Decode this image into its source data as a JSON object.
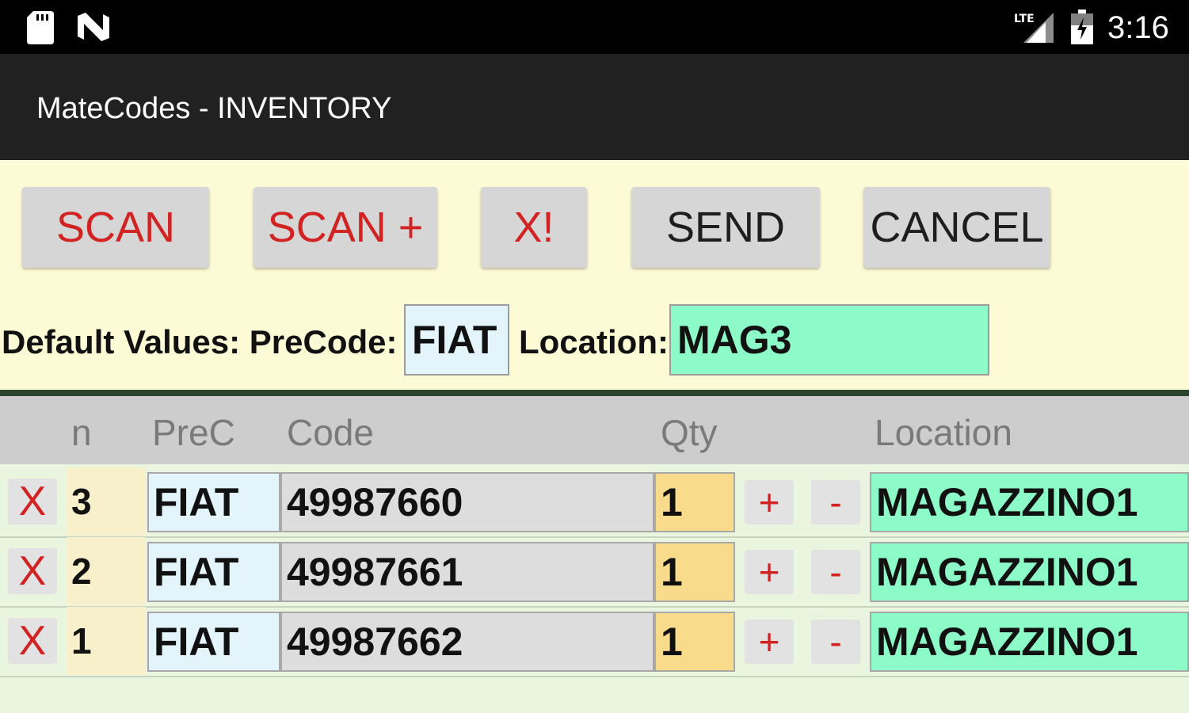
{
  "status_bar": {
    "time": "3:16",
    "icons": [
      "sd-card-icon",
      "nfc-icon",
      "lte-signal-icon",
      "battery-charging-icon"
    ]
  },
  "app": {
    "title": "MateCodes - INVENTORY"
  },
  "toolbar": {
    "scan_label": "SCAN",
    "scan_plus_label": "SCAN +",
    "delete_all_label": "X!",
    "send_label": "SEND",
    "cancel_label": "CANCEL"
  },
  "defaults": {
    "label": "Default Values: PreCode:",
    "precode_value": "FIAT",
    "location_label": "Location:",
    "location_value": "MAG3"
  },
  "table": {
    "headers": {
      "n": "n",
      "prec": "PreC",
      "code": "Code",
      "qty": "Qty",
      "location": "Location"
    },
    "rows": [
      {
        "delete": "X",
        "n": "3",
        "prec": "FIAT",
        "code": "49987660",
        "qty": "1",
        "plus": "+",
        "minus": "-",
        "location": "MAGAZZINO1"
      },
      {
        "delete": "X",
        "n": "2",
        "prec": "FIAT",
        "code": "49987661",
        "qty": "1",
        "plus": "+",
        "minus": "-",
        "location": "MAGAZZINO1"
      },
      {
        "delete": "X",
        "n": "1",
        "prec": "FIAT",
        "code": "49987662",
        "qty": "1",
        "plus": "+",
        "minus": "-",
        "location": "MAGAZZINO1"
      }
    ]
  },
  "colors": {
    "status_bar": "#000000",
    "title_bar": "#212121",
    "header_bg": "#fdfad6",
    "accent_red": "#d32222",
    "location_green": "#8dfbc7",
    "qty_yellow": "#f8dc8c"
  }
}
